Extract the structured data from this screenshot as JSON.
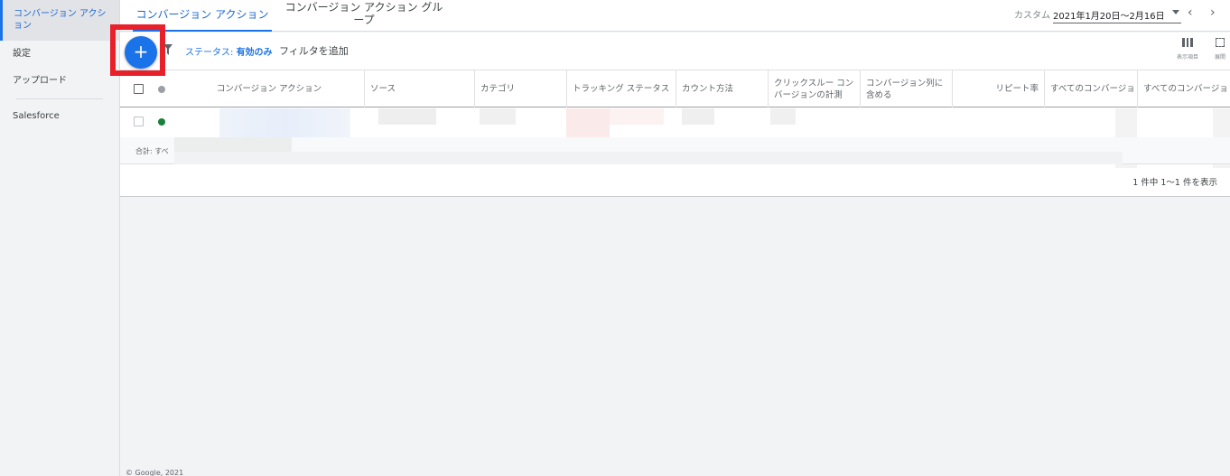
{
  "sidebar": {
    "items": [
      {
        "label": "コンバージョン アクション",
        "active": true
      },
      {
        "label": "設定"
      },
      {
        "label": "アップロード"
      },
      {
        "label": "Salesforce"
      }
    ]
  },
  "tabs": [
    {
      "label": "コンバージョン アクション"
    },
    {
      "label": "コンバージョン アクション グループ"
    }
  ],
  "date": {
    "label": "カスタム",
    "range": "2021年1月20日～2月16日"
  },
  "toolbar": {
    "add_label": "+",
    "status_prefix": "ステータス: ",
    "status_value": "有効のみ",
    "add_filter": "フィルタを追加",
    "columns_label": "表示項目",
    "expand_label": "展開"
  },
  "table": {
    "headers": [
      "コンバージョン アクション",
      "ソース",
      "カテゴリ",
      "トラッキング ステータス",
      "カウント方法",
      "クリックスルー コンバージョンの計測",
      "コンバージョン列に含める",
      "リピート率",
      "すべてのコンバージョ",
      "すべてのコンバージョ"
    ],
    "total_label": "合計: すべ",
    "pager": "1 件中 1～1 件を表示"
  },
  "colors": {
    "accent": "#1a73e8",
    "highlight": "#e8202a",
    "status_enabled": "#188038",
    "status_header": "#9aa0a6"
  },
  "footer": "© Google, 2021"
}
